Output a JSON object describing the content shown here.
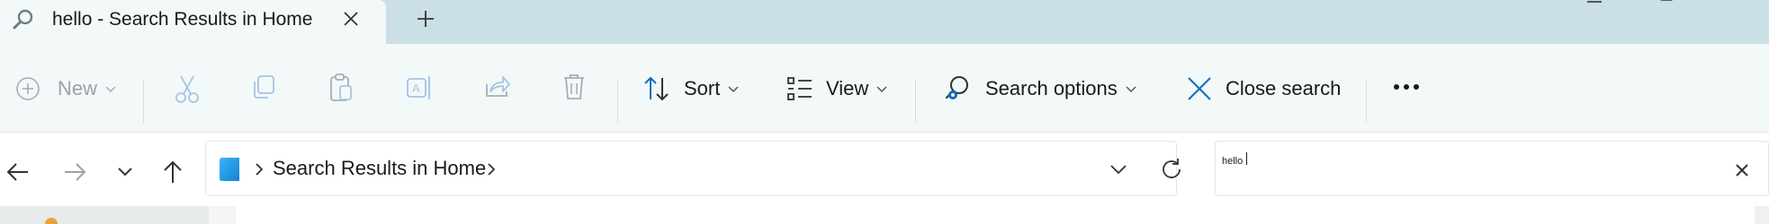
{
  "tab": {
    "title": "hello - Search Results in Home",
    "icon": "search-icon"
  },
  "toolbar": {
    "new_label": "New",
    "sort_label": "Sort",
    "view_label": "View",
    "search_options_label": "Search options",
    "close_search_label": "Close search",
    "icons": [
      "plus-circle-icon",
      "cut-icon",
      "copy-icon",
      "paste-icon",
      "rename-icon",
      "share-icon",
      "delete-icon",
      "sort-icon",
      "view-icon",
      "search-options-icon",
      "close-icon",
      "more-icon"
    ]
  },
  "address": {
    "path_label": "Search Results in Home"
  },
  "search": {
    "value": "hello"
  },
  "colors": {
    "titlebar": "#cbdfe6",
    "commandbar": "#f3f8f9",
    "accent": "#0f6cbd"
  }
}
